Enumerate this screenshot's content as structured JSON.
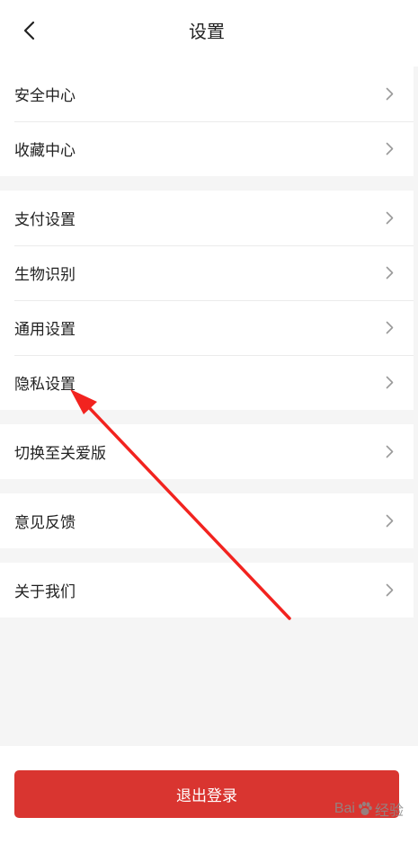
{
  "header": {
    "title": "设置"
  },
  "groups": [
    {
      "items": [
        {
          "label": "安全中心"
        },
        {
          "label": "收藏中心"
        }
      ]
    },
    {
      "items": [
        {
          "label": "支付设置"
        },
        {
          "label": "生物识别"
        },
        {
          "label": "通用设置"
        },
        {
          "label": "隐私设置"
        }
      ]
    },
    {
      "items": [
        {
          "label": "切换至关爱版"
        }
      ]
    },
    {
      "items": [
        {
          "label": "意见反馈"
        }
      ]
    },
    {
      "items": [
        {
          "label": "关于我们"
        }
      ]
    }
  ],
  "footer": {
    "logout_label": "退出登录"
  },
  "watermark": {
    "brand_left": "Bai",
    "brand_right": "经验"
  },
  "colors": {
    "accent_red": "#d93530",
    "annotation_red": "#f2231f",
    "background": "#f5f5f5"
  }
}
